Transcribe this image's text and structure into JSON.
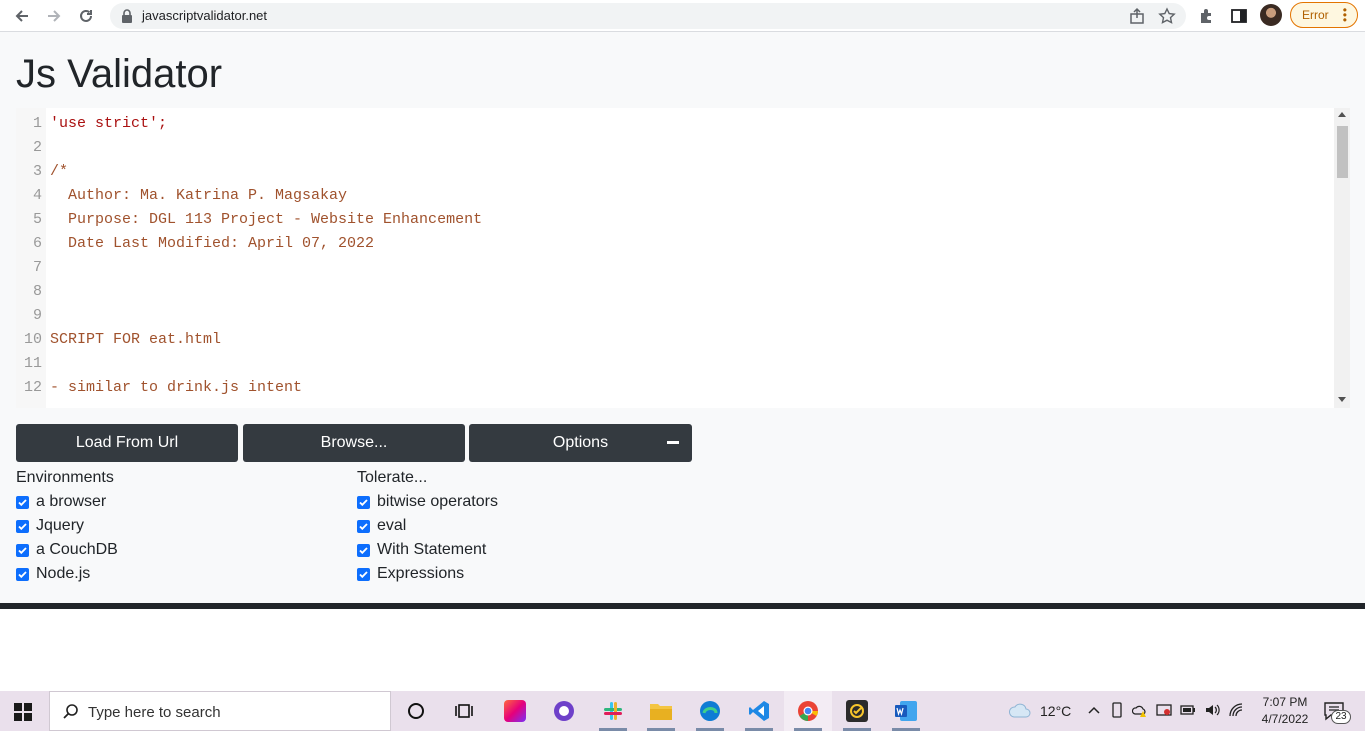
{
  "browser": {
    "url": "javascriptvalidator.net",
    "error_label": "Error"
  },
  "page": {
    "title": "Js Validator"
  },
  "editor": {
    "lines": [
      {
        "num": "1",
        "text": "'use strict';",
        "style": "str"
      },
      {
        "num": "2",
        "text": "",
        "style": "plain"
      },
      {
        "num": "3",
        "text": "/*",
        "style": "comment"
      },
      {
        "num": "4",
        "text": "  Author: Ma. Katrina P. Magsakay",
        "style": "comment"
      },
      {
        "num": "5",
        "text": "  Purpose: DGL 113 Project - Website Enhancement",
        "style": "comment"
      },
      {
        "num": "6",
        "text": "  Date Last Modified: April 07, 2022",
        "style": "comment"
      },
      {
        "num": "7",
        "text": "",
        "style": "comment"
      },
      {
        "num": "8",
        "text": "",
        "style": "comment"
      },
      {
        "num": "9",
        "text": "",
        "style": "comment"
      },
      {
        "num": "10",
        "text": "SCRIPT FOR eat.html",
        "style": "comment"
      },
      {
        "num": "11",
        "text": "",
        "style": "comment"
      },
      {
        "num": "12",
        "text": "- similar to drink.js intent",
        "style": "comment"
      }
    ]
  },
  "buttons": {
    "load_url": "Load From Url",
    "browse": "Browse...",
    "options": "Options"
  },
  "environments": {
    "heading": "Environments",
    "items": [
      {
        "label": "a browser",
        "checked": true
      },
      {
        "label": "Jquery",
        "checked": true
      },
      {
        "label": "a CouchDB",
        "checked": true
      },
      {
        "label": "Node.js",
        "checked": true
      }
    ]
  },
  "tolerate": {
    "heading": "Tolerate...",
    "items": [
      {
        "label": "bitwise operators",
        "checked": true
      },
      {
        "label": "eval",
        "checked": true
      },
      {
        "label": "With Statement",
        "checked": true
      },
      {
        "label": "Expressions",
        "checked": true
      }
    ]
  },
  "taskbar": {
    "search_placeholder": "Type here to search",
    "temperature": "12°C",
    "time": "7:07 PM",
    "date": "4/7/2022",
    "notification_count": "23"
  },
  "colors": {
    "button_bg": "#343a40",
    "checkbox": "#0d6efd",
    "comment": "#a0522d",
    "string": "#aa1111"
  }
}
